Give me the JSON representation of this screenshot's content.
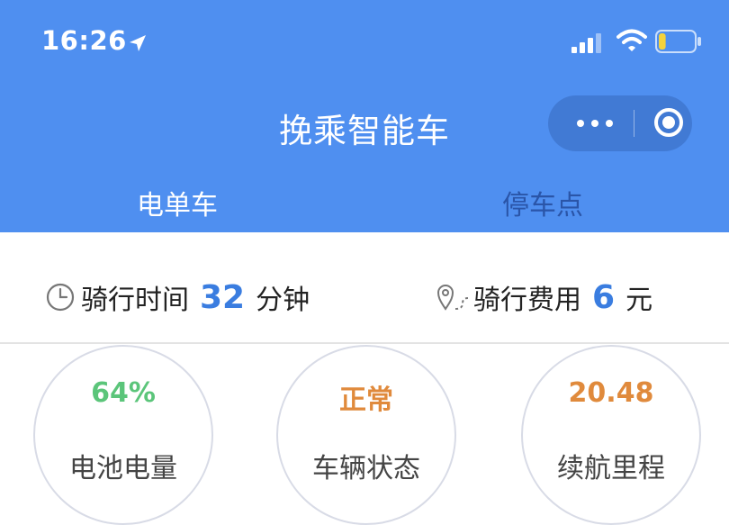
{
  "status_bar": {
    "time": "16:26",
    "battery_level": 0.2
  },
  "app": {
    "title": "挽乘智能车"
  },
  "tabs": [
    {
      "label": "电单车",
      "active": true
    },
    {
      "label": "停车点",
      "active": false
    }
  ],
  "ride_info": {
    "time": {
      "label": "骑行时间",
      "value": "32",
      "unit": "分钟"
    },
    "cost": {
      "label": "骑行费用",
      "value": "6",
      "unit": "元"
    }
  },
  "stats": [
    {
      "value": "64%",
      "label": "电池电量",
      "color": "#5bc57a"
    },
    {
      "value": "正常",
      "label": "车辆状态",
      "color": "#e08a3c"
    },
    {
      "value": "20.48",
      "label": "续航里程",
      "color": "#e08a3c"
    }
  ],
  "colors": {
    "header": "#4f8ff0",
    "accent": "#3a7de0"
  }
}
